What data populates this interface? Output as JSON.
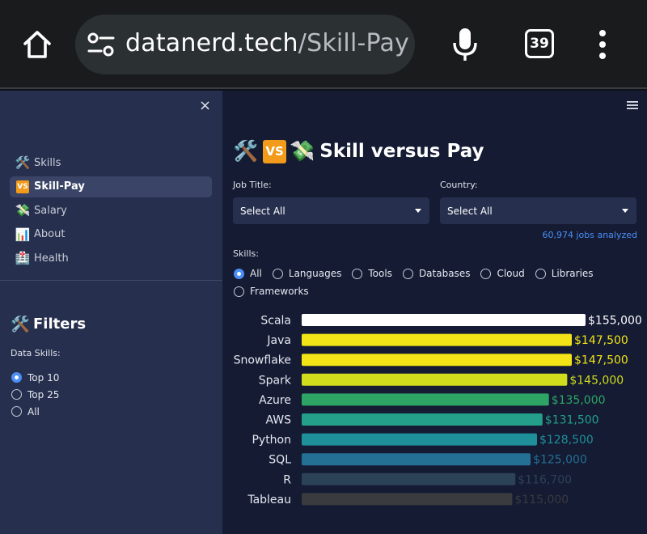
{
  "browser": {
    "url_host": "datanerd.tech",
    "url_path": "/Skill-Pay",
    "tab_count": "39",
    "icons": [
      "home-icon",
      "tune-icon",
      "mic-icon",
      "tabs-icon",
      "more-vert-icon"
    ]
  },
  "sidebar": {
    "close_label": "×",
    "nav": [
      {
        "label": "Skills",
        "icon": "hammer-wrench-icon",
        "glyph": "🛠️"
      },
      {
        "label": "Skill-Pay",
        "icon": "vs-icon",
        "glyph": "VS",
        "active": true
      },
      {
        "label": "Salary",
        "icon": "money-icon",
        "glyph": "💸"
      },
      {
        "label": "About",
        "icon": "bar-chart-icon",
        "glyph": "📊"
      },
      {
        "label": "Health",
        "icon": "hospital-icon",
        "glyph": "🏥"
      }
    ],
    "filters": {
      "title": "Filters",
      "title_glyph": "🛠️",
      "data_skills_label": "Data Skills:",
      "options": [
        "Top 10",
        "Top 25",
        "All"
      ],
      "selected": "Top 10"
    }
  },
  "main": {
    "title": "Skill versus Pay",
    "title_glyphs": {
      "left": "🛠️",
      "vs": "VS",
      "right": "💸"
    },
    "job_title_label": "Job Title:",
    "job_title_value": "Select All",
    "country_label": "Country:",
    "country_value": "Select All",
    "jobs_analyzed": "60,974 jobs analyzed",
    "skills_label": "Skills:",
    "skill_options": [
      "All",
      "Languages",
      "Tools",
      "Databases",
      "Cloud",
      "Libraries",
      "Frameworks"
    ],
    "skill_selected": "All"
  },
  "colors": {
    "accent": "#4c8ef7",
    "vs_orange": "#f29a1a"
  },
  "chart_data": {
    "type": "bar",
    "orientation": "horizontal",
    "categories": [
      "Scala",
      "Java",
      "Snowflake",
      "Spark",
      "Azure",
      "AWS",
      "Python",
      "SQL",
      "R",
      "Tableau"
    ],
    "values": [
      155000,
      147500,
      147500,
      145000,
      135000,
      131500,
      128500,
      125000,
      116700,
      115000
    ],
    "value_labels": [
      "$155,000",
      "$147,500",
      "$147,500",
      "$145,000",
      "$135,000",
      "$131,500",
      "$128,500",
      "$125,000",
      "$116,700",
      "$115,000"
    ],
    "bar_colors": [
      "#ffffff",
      "#f2e416",
      "#f2e416",
      "#d0dc1c",
      "#2ea564",
      "#24a08a",
      "#1f8f9a",
      "#246f94",
      "#2c4256",
      "#3a3b3e"
    ],
    "label_colors": [
      "#ffffff",
      "#f2e416",
      "#f2e416",
      "#d0dc1c",
      "#2ea564",
      "#24a08a",
      "#1f8f9a",
      "#246f94",
      "#2c4256",
      "#3a3b3e"
    ],
    "xlim": [
      0,
      155000
    ],
    "grid": false
  }
}
